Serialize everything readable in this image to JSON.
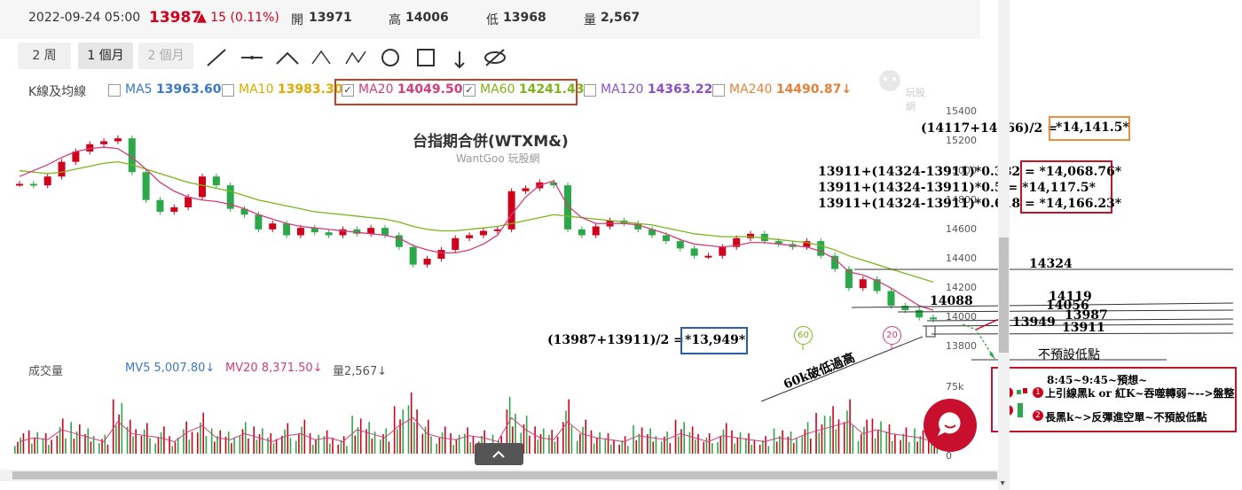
{
  "header": {
    "date": "2022-09-24 05:00",
    "price": "13987",
    "change": "▲ 15 (0.11%)",
    "open_label": "開",
    "open": "13971",
    "high_label": "高",
    "high": "14006",
    "low_label": "低",
    "low": "13968",
    "vol_label": "量",
    "vol": "2,567"
  },
  "ranges": [
    "2 周",
    "1 個月",
    "2 個月"
  ],
  "ma": {
    "title": "K線及均線",
    "items": [
      {
        "label": "MA5",
        "value": "13963.60↓",
        "color": "#3a78c6",
        "checked": false
      },
      {
        "label": "MA10",
        "value": "13983.30↓",
        "color": "#e0a800",
        "checked": false
      },
      {
        "label": "MA20",
        "value": "14049.50↓",
        "color": "#d43c7a",
        "checked": true
      },
      {
        "label": "MA60",
        "value": "14241.43↓",
        "color": "#7cb518",
        "checked": true
      },
      {
        "label": "MA120",
        "value": "14363.22↓",
        "color": "#8a4fc4",
        "checked": false
      },
      {
        "label": "MA240",
        "value": "14490.87↓",
        "color": "#e8803a",
        "checked": false
      }
    ]
  },
  "chart": {
    "title": "台指期合併(WTXM&)",
    "subtitle": "WantGoo 玩股網",
    "logo": "玩股網"
  },
  "yaxis": [
    "15400",
    "15200",
    "15000",
    "14800",
    "14600",
    "14400",
    "14200",
    "14000",
    "13800"
  ],
  "volume": {
    "title": "成交量",
    "mv5": "MV5 5,007.80↓",
    "mv20": "MV20 8,371.50↓",
    "vol": "量2,567↓",
    "axis_top": "75k",
    "axis_zero": "0"
  },
  "markers": {
    "m60": "60",
    "m20": "20"
  },
  "annotations": {
    "a1": "(14117+14166)/2 = ",
    "a1v": "*14,141.5*",
    "f1": "13911+(14324-13911)*0.382 = *14,068.76*",
    "f2": "13911+(14324-13911)*0.5 = *14,117.5*",
    "f3": "13911+(14324-13911)*0.618 = *14,166.23*",
    "a2": "(13987+13911)/2 = ",
    "a2v": "*13,949*",
    "diag": "60k破低過高",
    "l14324": "14324",
    "l14119": "14119",
    "l14088": "14088",
    "l14056": "14056",
    "l13987": "13987",
    "l13949": "13949",
    "l13911": "13911",
    "nolow": "不預設低點",
    "plan_title": "8:45~9:45~預想~",
    "plan1": "上引線黑k or 紅K~吞噬轉弱~-->盤整",
    "plan2": "長黑k~>反彈進空單~不預設低點",
    "n1": "1",
    "n2": "2"
  },
  "chart_data": {
    "type": "candlestick",
    "title": "台指期合併(WTXM&)",
    "ylim": [
      13700,
      15450
    ],
    "close": [
      14910,
      14900,
      14960,
      15060,
      15130,
      15180,
      15200,
      15220,
      14990,
      14800,
      14720,
      14750,
      14820,
      14960,
      14900,
      14740,
      14700,
      14600,
      14640,
      14560,
      14610,
      14580,
      14560,
      14600,
      14570,
      14610,
      14560,
      14480,
      14360,
      14400,
      14460,
      14540,
      14560,
      14590,
      14600,
      14860,
      14880,
      14920,
      14900,
      14600,
      14560,
      14620,
      14660,
      14640,
      14600,
      14560,
      14520,
      14470,
      14420,
      14420,
      14480,
      14540,
      14570,
      14520,
      14500,
      14480,
      14520,
      14420,
      14330,
      14200,
      14260,
      14180,
      14080,
      14050,
      14000,
      13987
    ],
    "ma20": [
      14960,
      15000,
      15040,
      15090,
      15130,
      15150,
      15160,
      15150,
      15090,
      15010,
      14920,
      14860,
      14820,
      14800,
      14790,
      14770,
      14740,
      14700,
      14670,
      14640,
      14620,
      14610,
      14600,
      14590,
      14580,
      14570,
      14560,
      14540,
      14490,
      14460,
      14440,
      14440,
      14460,
      14500,
      14560,
      14700,
      14820,
      14900,
      14930,
      14760,
      14680,
      14640,
      14640,
      14640,
      14630,
      14600,
      14570,
      14530,
      14500,
      14490,
      14480,
      14490,
      14510,
      14510,
      14500,
      14490,
      14480,
      14450,
      14400,
      14310,
      14290,
      14250,
      14200,
      14140,
      14080,
      14049
    ],
    "ma60": [
      15000,
      14990,
      14980,
      14990,
      15010,
      15030,
      15050,
      15060,
      15040,
      15010,
      14980,
      14950,
      14920,
      14900,
      14880,
      14860,
      14830,
      14800,
      14780,
      14760,
      14740,
      14720,
      14710,
      14700,
      14690,
      14680,
      14670,
      14650,
      14620,
      14600,
      14590,
      14590,
      14600,
      14610,
      14620,
      14640,
      14660,
      14680,
      14700,
      14690,
      14680,
      14670,
      14660,
      14650,
      14640,
      14630,
      14610,
      14590,
      14570,
      14560,
      14550,
      14550,
      14550,
      14540,
      14530,
      14520,
      14510,
      14490,
      14460,
      14420,
      14390,
      14360,
      14330,
      14300,
      14270,
      14241
    ],
    "volume_levels": [
      0.3,
      0.4,
      0.35,
      0.6,
      0.5,
      0.4,
      0.3,
      0.8,
      0.5,
      0.45,
      0.4,
      0.3,
      0.55,
      0.7,
      0.4,
      0.35,
      0.5,
      0.4,
      0.3,
      0.45,
      0.5,
      0.35,
      0.4,
      0.3,
      0.6,
      0.5,
      0.4,
      0.7,
      0.9,
      0.5,
      0.4,
      0.35,
      0.45,
      0.4,
      0.3,
      0.9,
      0.6,
      0.4,
      0.35,
      0.8,
      0.5,
      0.4,
      0.35,
      0.3,
      0.45,
      0.4,
      0.35,
      0.5,
      0.4,
      0.3,
      0.45,
      0.4,
      0.35,
      0.3,
      0.4,
      0.35,
      0.5,
      0.6,
      0.7,
      0.8,
      0.5,
      0.6,
      0.5,
      0.45,
      0.4,
      0.3
    ]
  }
}
